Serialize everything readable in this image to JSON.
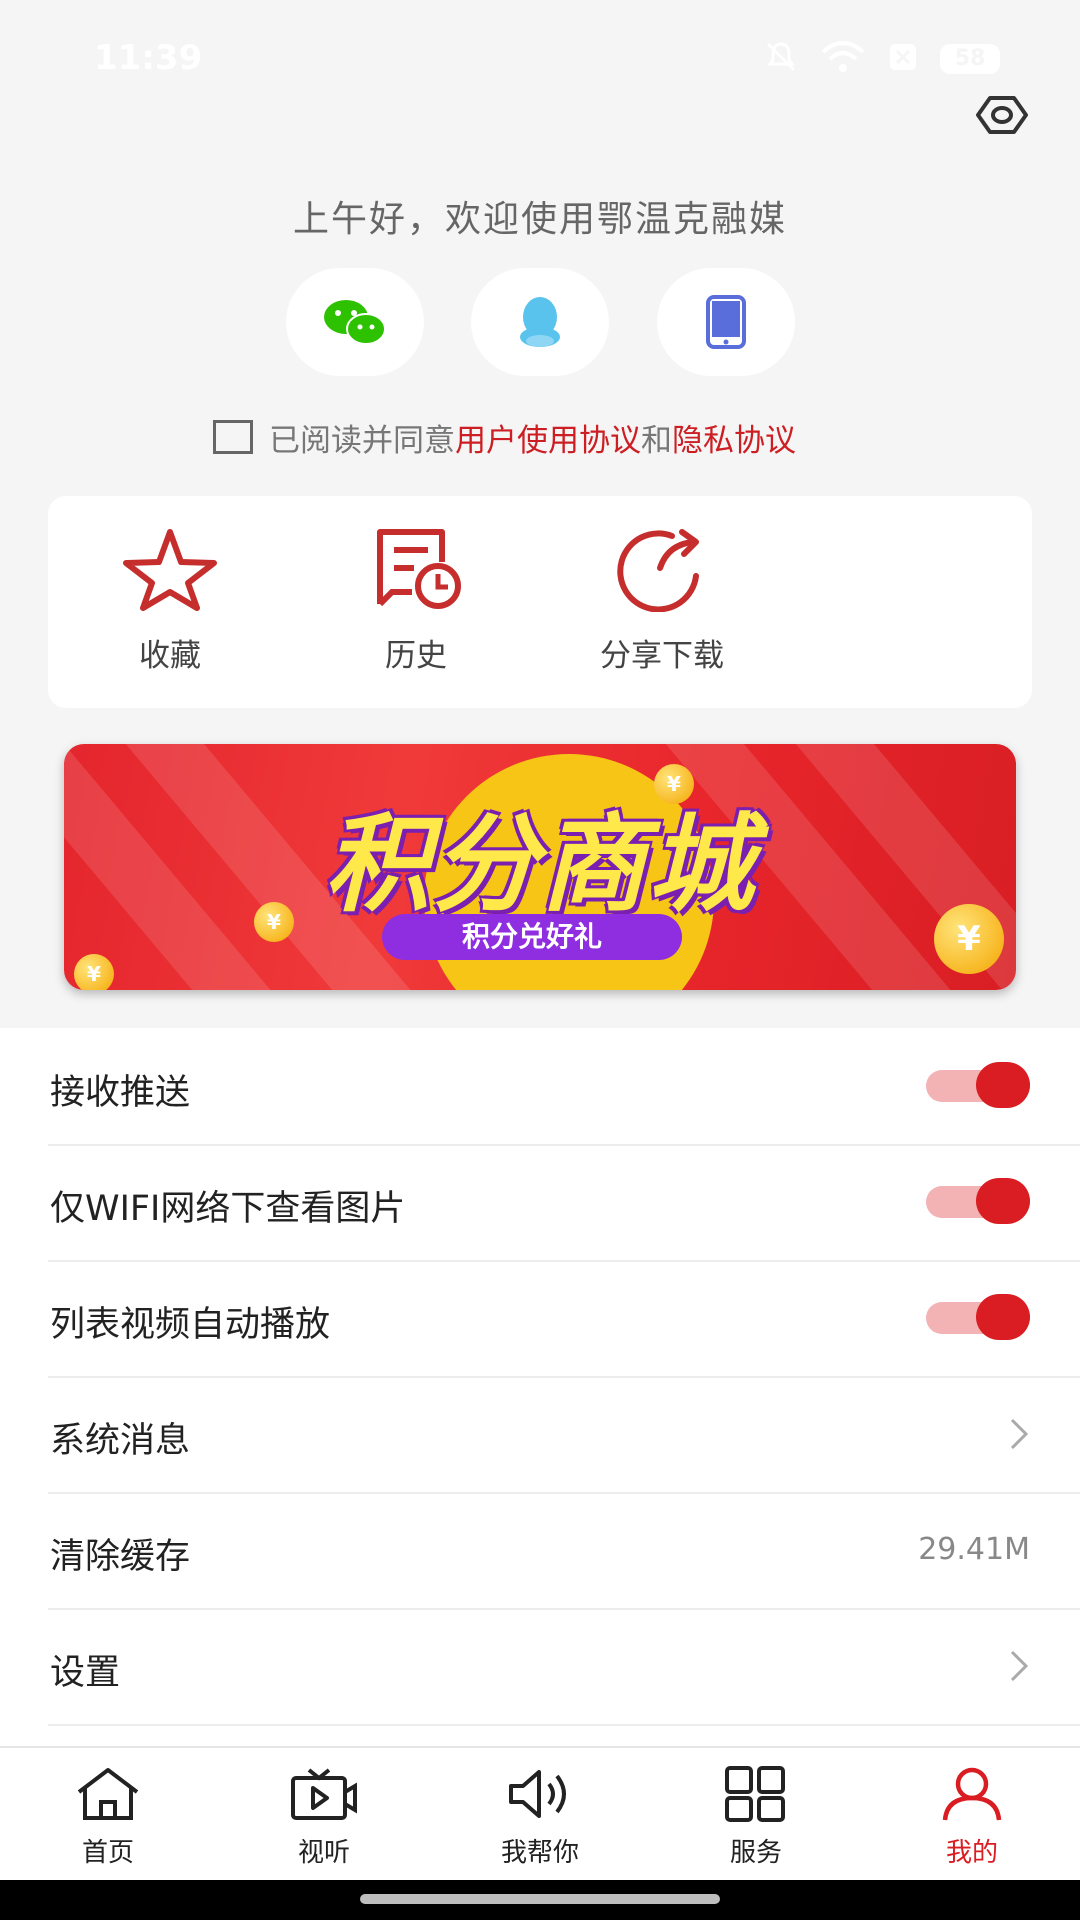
{
  "status_bar": {
    "time": "11:39",
    "battery": "58"
  },
  "greeting": "上午好，欢迎使用鄂温克融媒",
  "login_options": [
    {
      "name": "wechat",
      "icon": "wechat-icon"
    },
    {
      "name": "qq",
      "icon": "qq-icon"
    },
    {
      "name": "phone",
      "icon": "phone-icon"
    }
  ],
  "agreement": {
    "prefix": "已阅读并同意",
    "user_agreement": "用户使用协议",
    "and": "和",
    "privacy": "隐私协议"
  },
  "quick_actions": [
    {
      "label": "收藏",
      "icon": "star-icon"
    },
    {
      "label": "历史",
      "icon": "history-icon"
    },
    {
      "label": "分享下载",
      "icon": "share-icon"
    }
  ],
  "banner": {
    "title": "积分商城",
    "subtitle": "积分兑好礼",
    "coin_symbol": "¥"
  },
  "settings": {
    "push": "接收推送",
    "wifi_images": "仅WIFI网络下查看图片",
    "autoplay": "列表视频自动播放",
    "messages": "系统消息",
    "clear_cache": "清除缓存",
    "cache_size": "29.41M",
    "settings": "设置"
  },
  "toggles": {
    "push": true,
    "wifi_images": true,
    "autoplay": true
  },
  "tabs": [
    {
      "label": "首页",
      "icon": "home-icon"
    },
    {
      "label": "视听",
      "icon": "tv-icon"
    },
    {
      "label": "我帮你",
      "icon": "speaker-icon"
    },
    {
      "label": "服务",
      "icon": "grid-icon"
    },
    {
      "label": "我的",
      "icon": "user-icon",
      "active": true
    }
  ],
  "colors": {
    "accent": "#d91d22",
    "background": "#f5f5f5"
  }
}
